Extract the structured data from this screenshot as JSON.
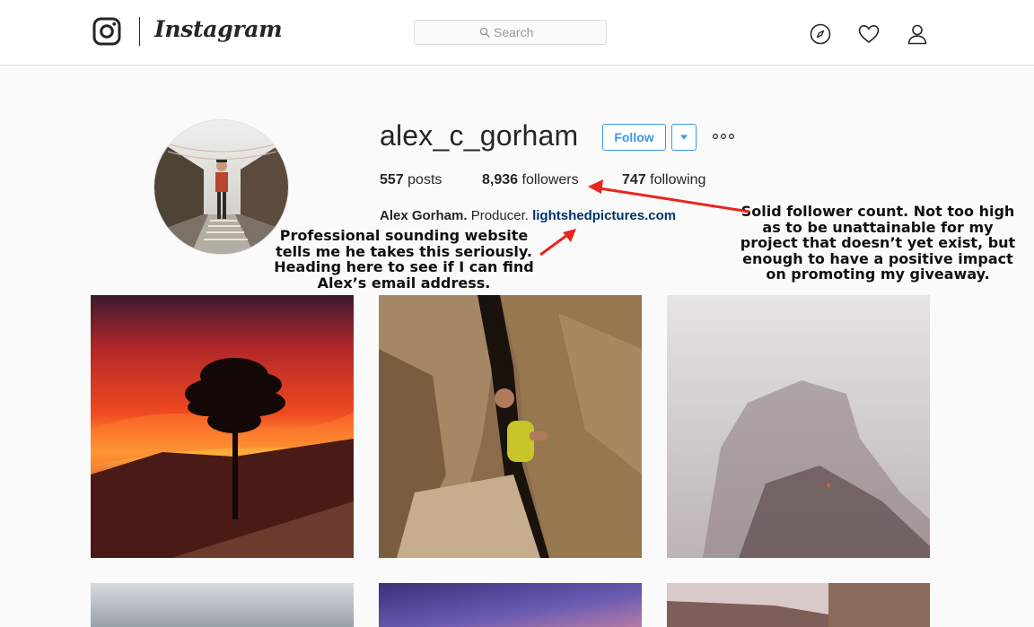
{
  "header": {
    "wordmark": "Instagram",
    "search_placeholder": "Search",
    "icons": [
      "instagram-logo-icon",
      "search-icon",
      "compass-icon",
      "heart-icon",
      "profile-icon"
    ]
  },
  "profile": {
    "username": "alex_c_gorham",
    "follow_label": "Follow",
    "stats": {
      "posts_count": "557",
      "posts_label": "posts",
      "followers_count": "8,936",
      "followers_label": "followers",
      "following_count": "747",
      "following_label": "following"
    },
    "bio": {
      "full_name": "Alex Gorham.",
      "description": "Producer.",
      "website": "lightshedpictures.com"
    }
  },
  "annotations": {
    "followers_note": "Solid follower count. Not too high as to be unattainable for my project that doesn’t yet exist, but enough to have a positive impact on promoting my giveaway.",
    "website_note": "Professional sounding website tells me he takes this seriously. Heading here to see if I can find Alex’s email address.",
    "arrow_color": "#e8261c"
  },
  "colors": {
    "accent": "#3897f0",
    "link": "#003569",
    "border": "#dbdbdb",
    "background": "#fafafa"
  }
}
